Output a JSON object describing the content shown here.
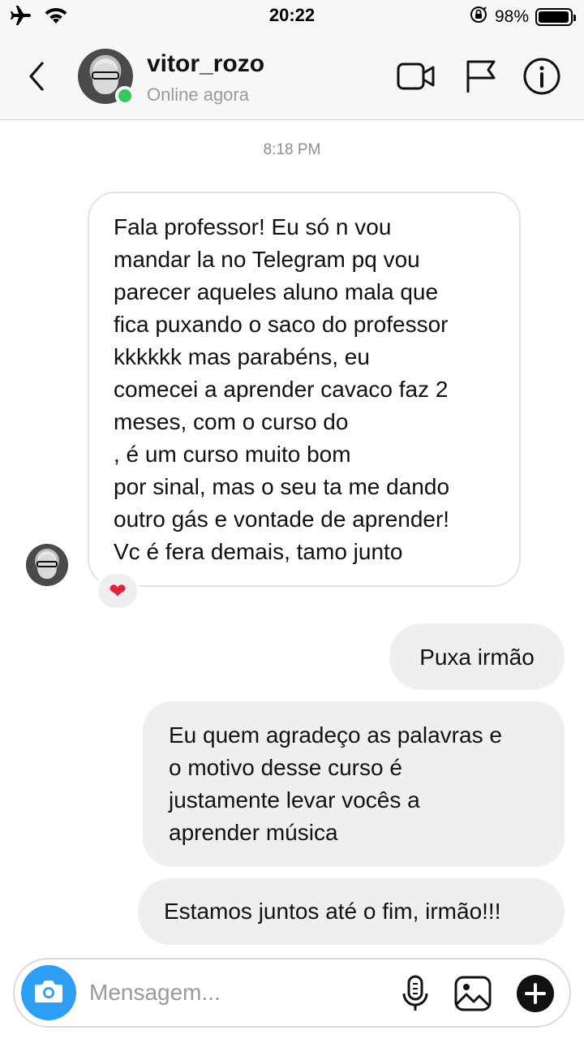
{
  "status_bar": {
    "time": "20:22",
    "battery_text": "98%",
    "battery_level": 0.98
  },
  "header": {
    "username": "vitor_rozo",
    "status": "Online agora"
  },
  "chat": {
    "timestamp": "8:18 PM",
    "incoming_message": "Fala professor! Eu só n vou\nmandar la no Telegram pq vou\nparecer aqueles aluno mala que\nfica puxando o saco do professor\nkkkkkk mas parabéns, eu\ncomecei a aprender cavaco faz 2\nmeses, com o curso do\n            , é um curso muito bom\npor sinal, mas o seu ta me dando\noutro gás e vontade de aprender!\nVc é fera demais, tamo junto",
    "reaction": "❤",
    "outgoing_messages": [
      "Puxa irmão",
      "Eu quem agradeço as palavras e\no motivo desse curso é\njustamente levar vocês a\naprender música",
      "Estamos juntos até o fim, irmão!!!"
    ]
  },
  "composer": {
    "placeholder": "Mensagem..."
  },
  "colors": {
    "online": "#35c759",
    "camera_button": "#2c9ef5",
    "reaction_heart": "#e0243b",
    "outgoing_bubble": "#efefef"
  },
  "icons": [
    "airplane-icon",
    "wifi-icon",
    "lock-rotation-icon",
    "battery-icon",
    "back-chevron-icon",
    "video-camera-icon",
    "flag-icon",
    "info-icon",
    "camera-icon",
    "microphone-icon",
    "gallery-icon",
    "plus-icon"
  ]
}
